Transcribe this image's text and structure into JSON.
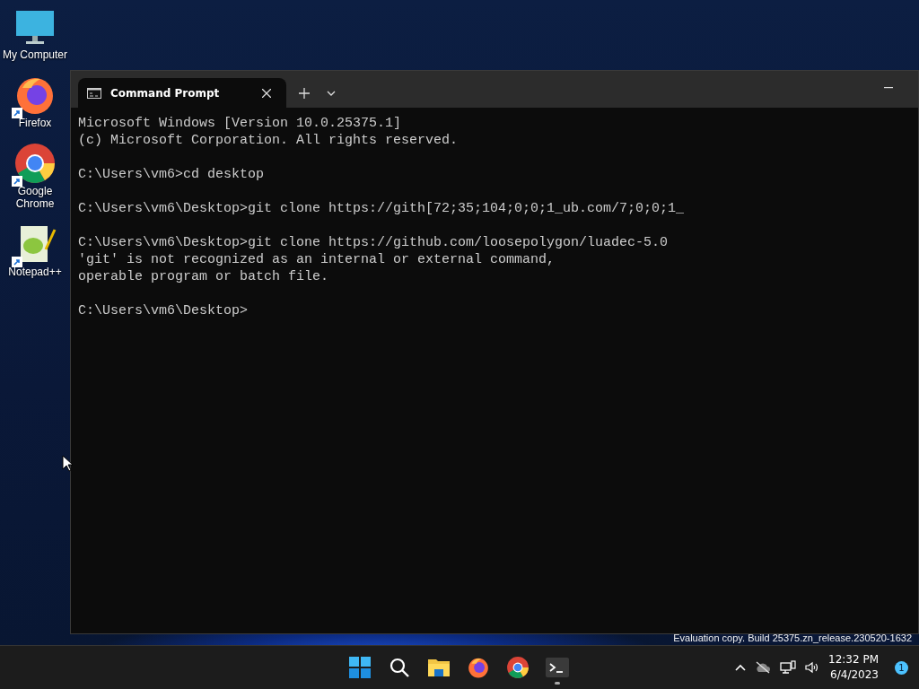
{
  "desktop_icons": [
    {
      "label": "My Computer",
      "kind": "computer",
      "shortcut": false
    },
    {
      "label": "Firefox",
      "kind": "firefox",
      "shortcut": true
    },
    {
      "label": "Google Chrome",
      "kind": "chrome",
      "shortcut": true
    },
    {
      "label": "Notepad++",
      "kind": "notepad",
      "shortcut": true
    }
  ],
  "window": {
    "tabs": [
      {
        "title": "Command Prompt",
        "selected": true
      }
    ],
    "console": {
      "blocks": [
        [
          "Microsoft Windows [Version 10.0.25375.1]",
          "(c) Microsoft Corporation. All rights reserved."
        ],
        [
          "C:\\Users\\vm6>cd desktop"
        ],
        [
          "C:\\Users\\vm6\\Desktop>git clone https://gith[72;35;104;0;0;1_ub.com/7;0;0;1_"
        ],
        [
          "C:\\Users\\vm6\\Desktop>git clone https://github.com/loosepolygon/luadec-5.0",
          "'git' is not recognized as an internal or external command,",
          "operable program or batch file."
        ],
        [
          "C:\\Users\\vm6\\Desktop>"
        ]
      ]
    }
  },
  "build_notice": "Evaluation copy. Build 25375.zn_release.230520-1632",
  "taskbar": {
    "apps": [
      {
        "kind": "start",
        "running": false
      },
      {
        "kind": "search",
        "running": false
      },
      {
        "kind": "folder",
        "running": false
      },
      {
        "kind": "firefox",
        "running": false
      },
      {
        "kind": "chrome",
        "running": false
      },
      {
        "kind": "terminal",
        "running": true
      }
    ],
    "tray": {
      "time": "12:32 PM",
      "date": "6/4/2023",
      "notification_count": "1"
    }
  }
}
